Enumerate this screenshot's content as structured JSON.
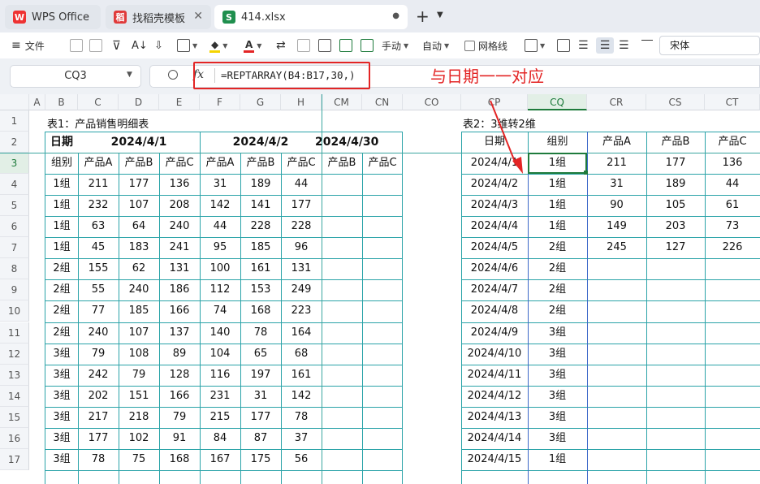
{
  "tabs": [
    {
      "label": "WPS Office",
      "icon": "W"
    },
    {
      "label": "找稻壳模板",
      "icon": "稻"
    },
    {
      "label": "414.xlsx",
      "icon": "S"
    }
  ],
  "toolbar": {
    "file_label": "文件",
    "manual_label": "手动",
    "auto_label": "自动",
    "gridlines_label": "网格线",
    "font_name": "宋体"
  },
  "formula_bar": {
    "cell_ref": "CQ3",
    "fx_label": "fx",
    "formula": "=REPTARRAY(B4:B17,30,)"
  },
  "annotation": "与日期一一对应",
  "columns": [
    "A",
    "B",
    "C",
    "D",
    "E",
    "F",
    "G",
    "H",
    "CM",
    "CN",
    "CO",
    "CP",
    "CQ",
    "CR",
    "CS",
    "CT"
  ],
  "rows": [
    "1",
    "2",
    "3",
    "4",
    "5",
    "6",
    "7",
    "8",
    "9",
    "10",
    "11",
    "12",
    "13",
    "14",
    "15",
    "16",
    "17"
  ],
  "table1": {
    "title": "表1：产品销售明细表",
    "date_label": "日期",
    "group_label": "组别",
    "dates": [
      "2024/4/1",
      "2024/4/2",
      "2024/4/30"
    ],
    "subheaders": [
      "产品A",
      "产品B",
      "产品C",
      "产品A",
      "产品B",
      "产品C",
      "产品B",
      "产品C"
    ],
    "rows": [
      [
        "1组",
        "211",
        "177",
        "136",
        "31",
        "189",
        "44"
      ],
      [
        "1组",
        "232",
        "107",
        "208",
        "142",
        "141",
        "177"
      ],
      [
        "1组",
        "63",
        "64",
        "240",
        "44",
        "228",
        "228"
      ],
      [
        "1组",
        "45",
        "183",
        "241",
        "95",
        "185",
        "96"
      ],
      [
        "2组",
        "155",
        "62",
        "131",
        "100",
        "161",
        "131"
      ],
      [
        "2组",
        "55",
        "240",
        "186",
        "112",
        "153",
        "249"
      ],
      [
        "2组",
        "77",
        "185",
        "166",
        "74",
        "168",
        "223"
      ],
      [
        "2组",
        "240",
        "107",
        "137",
        "140",
        "78",
        "164"
      ],
      [
        "3组",
        "79",
        "108",
        "89",
        "104",
        "65",
        "68"
      ],
      [
        "3组",
        "242",
        "79",
        "128",
        "116",
        "197",
        "161"
      ],
      [
        "3组",
        "202",
        "151",
        "166",
        "231",
        "31",
        "142"
      ],
      [
        "3组",
        "217",
        "218",
        "79",
        "215",
        "177",
        "78"
      ],
      [
        "3组",
        "177",
        "102",
        "91",
        "84",
        "87",
        "37"
      ],
      [
        "3组",
        "78",
        "75",
        "168",
        "167",
        "175",
        "56"
      ]
    ]
  },
  "table2": {
    "title": "表2：3维转2维",
    "headers": [
      "日期",
      "组别",
      "产品A",
      "产品B",
      "产品C"
    ],
    "rows": [
      [
        "2024/4/1",
        "1组",
        "211",
        "177",
        "136"
      ],
      [
        "2024/4/2",
        "1组",
        "31",
        "189",
        "44"
      ],
      [
        "2024/4/3",
        "1组",
        "90",
        "105",
        "61"
      ],
      [
        "2024/4/4",
        "1组",
        "149",
        "203",
        "73"
      ],
      [
        "2024/4/5",
        "2组",
        "245",
        "127",
        "226"
      ],
      [
        "2024/4/6",
        "2组",
        "",
        "",
        ""
      ],
      [
        "2024/4/7",
        "2组",
        "",
        "",
        ""
      ],
      [
        "2024/4/8",
        "2组",
        "",
        "",
        ""
      ],
      [
        "2024/4/9",
        "3组",
        "",
        "",
        ""
      ],
      [
        "2024/4/10",
        "3组",
        "",
        "",
        ""
      ],
      [
        "2024/4/11",
        "3组",
        "",
        "",
        ""
      ],
      [
        "2024/4/12",
        "3组",
        "",
        "",
        ""
      ],
      [
        "2024/4/13",
        "3组",
        "",
        "",
        ""
      ],
      [
        "2024/4/14",
        "3组",
        "",
        "",
        ""
      ],
      [
        "2024/4/15",
        "1组",
        "",
        "",
        ""
      ]
    ]
  },
  "colors": {
    "table_border": "#2aa3a8",
    "selection": "#1e7b3c",
    "annotation": "#e32525"
  }
}
